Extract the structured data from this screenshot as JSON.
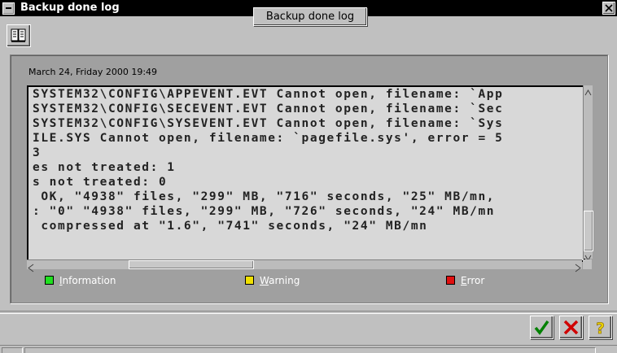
{
  "window": {
    "title": "Backup done log"
  },
  "header": {
    "title": "Backup done log"
  },
  "log": {
    "date": "March 24, Friday 2000 19:49",
    "lines": [
      "SYSTEM32\\CONFIG\\APPEVENT.EVT Cannot open, filename: `App",
      "SYSTEM32\\CONFIG\\SECEVENT.EVT Cannot open, filename: `Sec",
      "SYSTEM32\\CONFIG\\SYSEVENT.EVT Cannot open, filename: `Sys",
      "ILE.SYS Cannot open, filename: `pagefile.sys', error = 5",
      "3",
      "es not treated: 1",
      "s not treated: 0",
      " OK, \"4938\" files, \"299\" MB, \"716\" seconds, \"25\" MB/mn,",
      ": \"0\" \"4938\" files, \"299\" MB, \"726\" seconds, \"24\" MB/mn",
      " compressed at \"1.6\", \"741\" seconds, \"24\" MB/mn"
    ]
  },
  "legend": {
    "items": [
      {
        "label": "Information",
        "color": "#20e020"
      },
      {
        "label": "Warning",
        "color": "#f0e000"
      },
      {
        "label": "Error",
        "color": "#e01010"
      }
    ]
  },
  "buttons": {
    "ok_icon": "checkmark-icon",
    "cancel_icon": "x-icon",
    "help_icon": "question-icon"
  }
}
